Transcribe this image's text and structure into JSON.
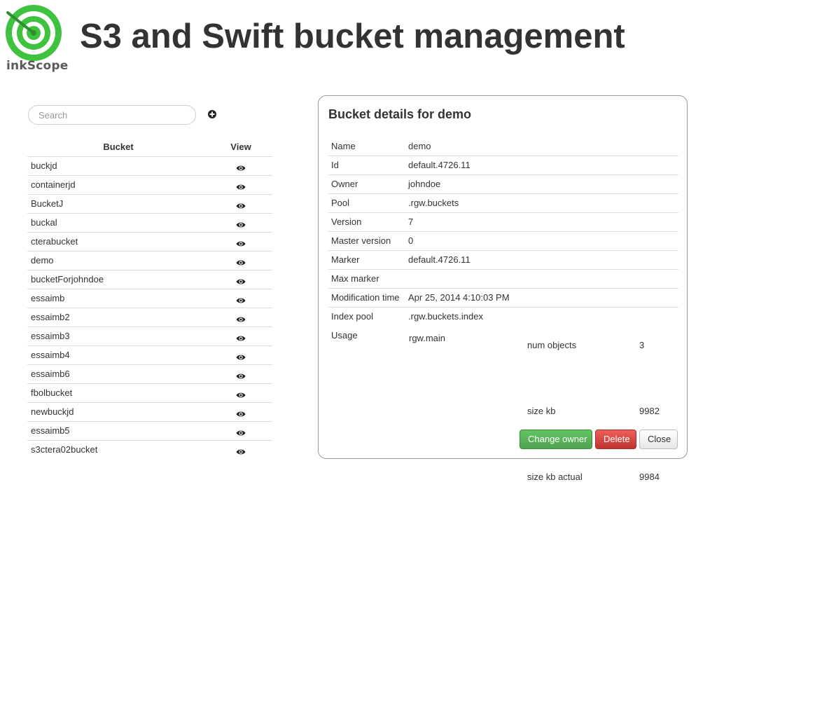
{
  "header": {
    "logo_text": "inkScope",
    "title": "S3 and Swift bucket management"
  },
  "search": {
    "placeholder": "Search"
  },
  "bucket_table": {
    "headers": {
      "bucket": "Bucket",
      "view": "View"
    },
    "rows": [
      "buckjd",
      "containerjd",
      "BucketJ",
      "buckal",
      "cterabucket",
      "demo",
      "bucketForjohndoe",
      "essaimb",
      "essaimb2",
      "essaimb3",
      "essaimb4",
      "essaimb6",
      "fbolbucket",
      "newbuckjd",
      "essaimb5",
      "s3ctera02bucket"
    ]
  },
  "details": {
    "title": "Bucket details for demo",
    "fields": [
      {
        "label": "Name",
        "value": "demo"
      },
      {
        "label": "Id",
        "value": "default.4726.11"
      },
      {
        "label": "Owner",
        "value": "johndoe"
      },
      {
        "label": "Pool",
        "value": ".rgw.buckets"
      },
      {
        "label": "Version",
        "value": "7"
      },
      {
        "label": "Master version",
        "value": "0"
      },
      {
        "label": "Marker",
        "value": "default.4726.11"
      },
      {
        "label": "Max marker",
        "value": ""
      },
      {
        "label": "Modification time",
        "value": "Apr 25, 2014 4:10:03 PM"
      },
      {
        "label": "Index pool",
        "value": ".rgw.buckets.index"
      }
    ],
    "usage": {
      "label": "Usage",
      "pool": "rgw.main",
      "stats": [
        {
          "label": "num objects",
          "value": "3"
        },
        {
          "label": "size kb",
          "value": "9982"
        },
        {
          "label": "size kb actual",
          "value": "9984"
        }
      ]
    },
    "buttons": {
      "change_owner": "Change owner",
      "delete": "Delete",
      "close": "Close"
    }
  },
  "colors": {
    "logo_green": "#3fc23f",
    "success": "#5bb75b",
    "danger": "#da4f49"
  },
  "icons": {
    "logo": "target-logo",
    "add": "plus-circle-icon",
    "view": "eye-icon"
  }
}
